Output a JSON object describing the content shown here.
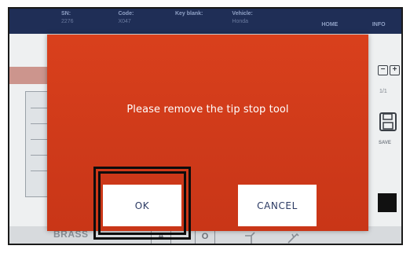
{
  "header": {
    "sn": {
      "label": "SN:",
      "value": "2276"
    },
    "code": {
      "label": "Code:",
      "value": "X047"
    },
    "key_blank": {
      "label": "Key blank:",
      "value": ""
    },
    "vehicle": {
      "label": "Vehicle:",
      "value": "Honda"
    },
    "home_label": "HOME",
    "info_label": "INFO"
  },
  "right_tools": {
    "minus_label": "−",
    "plus_label": "+",
    "page_indicator": "1/1",
    "save_label": "SAVE"
  },
  "bottom_bar": {
    "material_label": "BRASS",
    "btn_a_label": "A",
    "btn_o_label": "O"
  },
  "dialog": {
    "message": "Please remove the tip stop tool",
    "ok_label": "OK",
    "cancel_label": "CANCEL",
    "background_color": "#d9401c",
    "button_text_color": "#2b3a63"
  }
}
